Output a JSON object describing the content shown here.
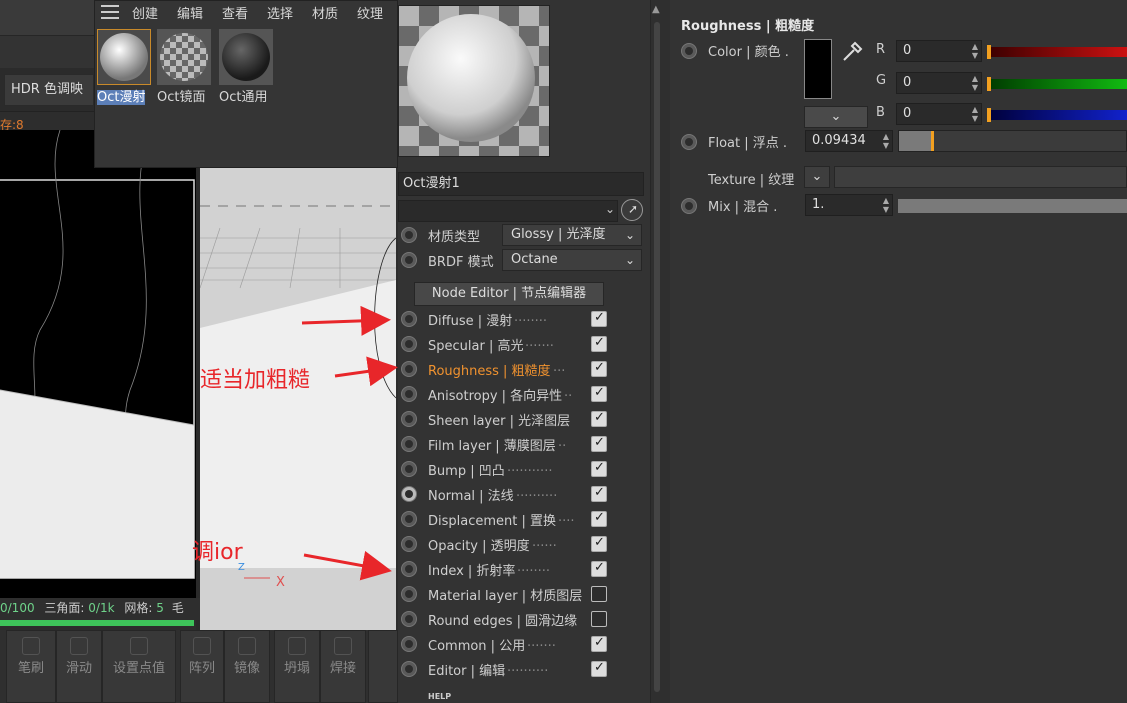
{
  "material_menu": [
    "创建",
    "编辑",
    "查看",
    "选择",
    "材质",
    "纹理"
  ],
  "materials": [
    {
      "label": "Oct漫射",
      "selected": true
    },
    {
      "label": "Oct镜面",
      "selected": false
    },
    {
      "label": "Oct通用",
      "selected": false
    }
  ],
  "left": {
    "hdr_button": "HDR 色调映",
    "cache_label": "存:8",
    "stats": {
      "count": "0/100",
      "tri_label": "三角面:",
      "tri_value": "0/1k",
      "grid_label": "网格:",
      "grid_value": "5",
      "extra": "毛"
    },
    "tools": [
      "笔刷",
      "滑动",
      "设置点值",
      "阵列",
      "镜像",
      "坍塌",
      "焊接"
    ]
  },
  "attributes": {
    "material_name": "Oct漫射1",
    "material_type_label": "材质类型",
    "material_type_value": "Glossy | 光泽度",
    "brdf_label": "BRDF 模式",
    "brdf_value": "Octane",
    "node_editor": "Node Editor | 节点编辑器",
    "channels": [
      {
        "label": "Diffuse | 漫射",
        "dots": "........",
        "checked": true,
        "active": false
      },
      {
        "label": "Specular | 高光",
        "dots": ".......",
        "checked": true,
        "active": false
      },
      {
        "label": "Roughness | 粗糙度",
        "dots": "...",
        "checked": true,
        "active": true
      },
      {
        "label": "Anisotropy | 各向异性",
        "dots": "..",
        "checked": true,
        "active": false
      },
      {
        "label": "Sheen layer | 光泽图层",
        "dots": "",
        "checked": true,
        "active": false
      },
      {
        "label": "Film layer | 薄膜图层",
        "dots": "..",
        "checked": true,
        "active": false
      },
      {
        "label": "Bump | 凹凸",
        "dots": "...........",
        "checked": true,
        "active": false
      },
      {
        "label": "Normal | 法线",
        "dots": "..........",
        "checked": true,
        "active": false
      },
      {
        "label": "Displacement | 置换",
        "dots": "....",
        "checked": true,
        "active": false
      },
      {
        "label": "Opacity | 透明度",
        "dots": "......",
        "checked": true,
        "active": false
      },
      {
        "label": "Index | 折射率",
        "dots": "........",
        "checked": true,
        "active": false
      },
      {
        "label": "Material layer | 材质图层",
        "dots": "",
        "checked": false,
        "active": false
      },
      {
        "label": "Round edges | 圆滑边缘",
        "dots": "",
        "checked": false,
        "active": false
      },
      {
        "label": "Common | 公用",
        "dots": ".......",
        "checked": true,
        "active": false
      },
      {
        "label": "Editor | 编辑",
        "dots": "..........",
        "checked": true,
        "active": false
      }
    ],
    "help": "HELP"
  },
  "roughness_panel": {
    "title": "Roughness | 粗糙度",
    "color_label": "Color | 颜色 .",
    "r_label": "R",
    "r_value": "0",
    "g_label": "G",
    "g_value": "0",
    "b_label": "B",
    "b_value": "0",
    "float_label": "Float | 浮点 .",
    "float_value": "0.09434",
    "float_fraction": 0.09434,
    "texture_label": "Texture | 纹理",
    "mix_label": "Mix | 混合 .",
    "mix_value": "1.",
    "colors": {
      "r": "#cc1111",
      "g": "#11bb11",
      "b": "#1122cc",
      "accent": "#f2a020"
    }
  },
  "annotations": {
    "rough_note": "适当加粗糙",
    "ior_note": "调ior"
  }
}
